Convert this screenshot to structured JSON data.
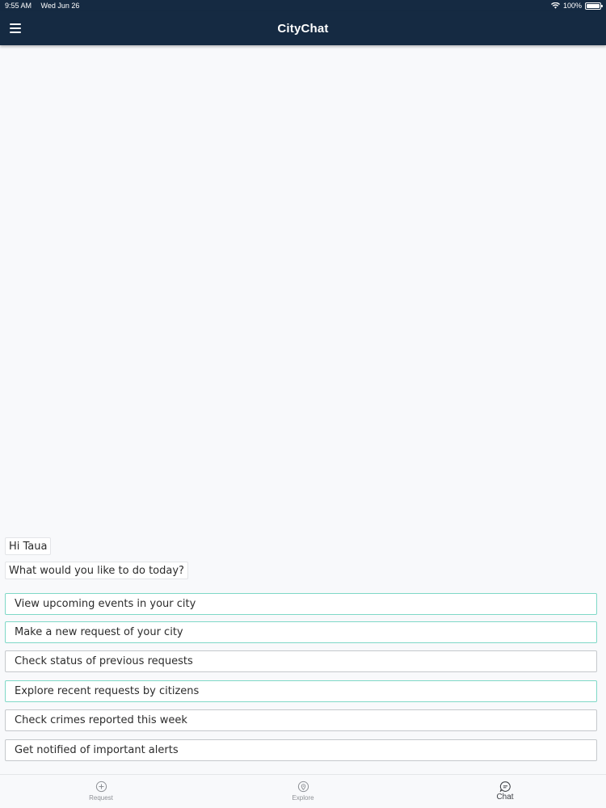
{
  "status_bar": {
    "time": "9:55 AM",
    "date": "Wed Jun 26",
    "battery": "100%"
  },
  "nav": {
    "title": "CityChat",
    "menu_icon": "hamburger-menu-icon"
  },
  "chat": {
    "greeting": "Hi Taua",
    "question": "What would you like to do today?",
    "options": [
      {
        "label": "View upcoming events in your city",
        "accent": true
      },
      {
        "label": "Make a new request of your city",
        "accent": true
      },
      {
        "label": "Check status of previous requests",
        "accent": false
      },
      {
        "label": "Explore recent requests by citizens",
        "accent": true
      },
      {
        "label": "Check crimes reported this week",
        "accent": false
      },
      {
        "label": "Get notified of important alerts",
        "accent": false
      }
    ]
  },
  "tabs": [
    {
      "label": "Request",
      "icon": "plus-circle-icon",
      "active": false
    },
    {
      "label": "Explore",
      "icon": "map-pin-icon",
      "active": false
    },
    {
      "label": "Chat",
      "icon": "chat-bubble-icon",
      "active": true
    }
  ],
  "colors": {
    "header_bg": "#152a42",
    "accent_border": "#7fd8c7",
    "plain_border": "#c5c8cc",
    "background": "#f8f9fb"
  }
}
